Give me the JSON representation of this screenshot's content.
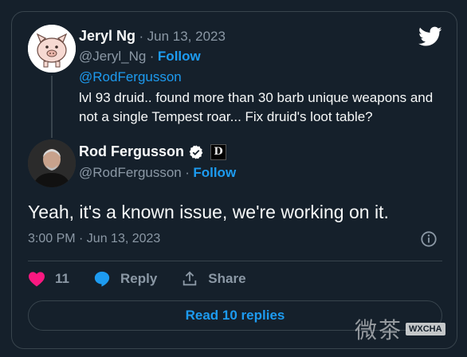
{
  "quoted": {
    "name": "Jeryl Ng",
    "separator": "·",
    "date": "Jun 13, 2023",
    "handle": "@Jeryl_Ng",
    "follow": "Follow",
    "mention": "@RodFergusson",
    "text": "lvl 93 druid.. found more than 30 barb unique weapons and not a single Tempest roar... Fix druid's loot table?"
  },
  "author": {
    "name": "Rod Fergusson",
    "affiliate_badge": "D",
    "handle": "@RodFergusson",
    "follow": "Follow"
  },
  "tweet": {
    "text": "Yeah, it's a known issue, we're working on it.",
    "timestamp": "3:00 PM · Jun 13, 2023"
  },
  "actions": {
    "like_count": "11",
    "reply_label": "Reply",
    "share_label": "Share"
  },
  "replies_button": "Read 10 replies",
  "watermark": {
    "text": "微茶",
    "badge": "WXCHA"
  },
  "colors": {
    "background": "#15202b",
    "accent": "#1d9bf0",
    "like": "#f91880",
    "muted": "#8b98a5"
  }
}
